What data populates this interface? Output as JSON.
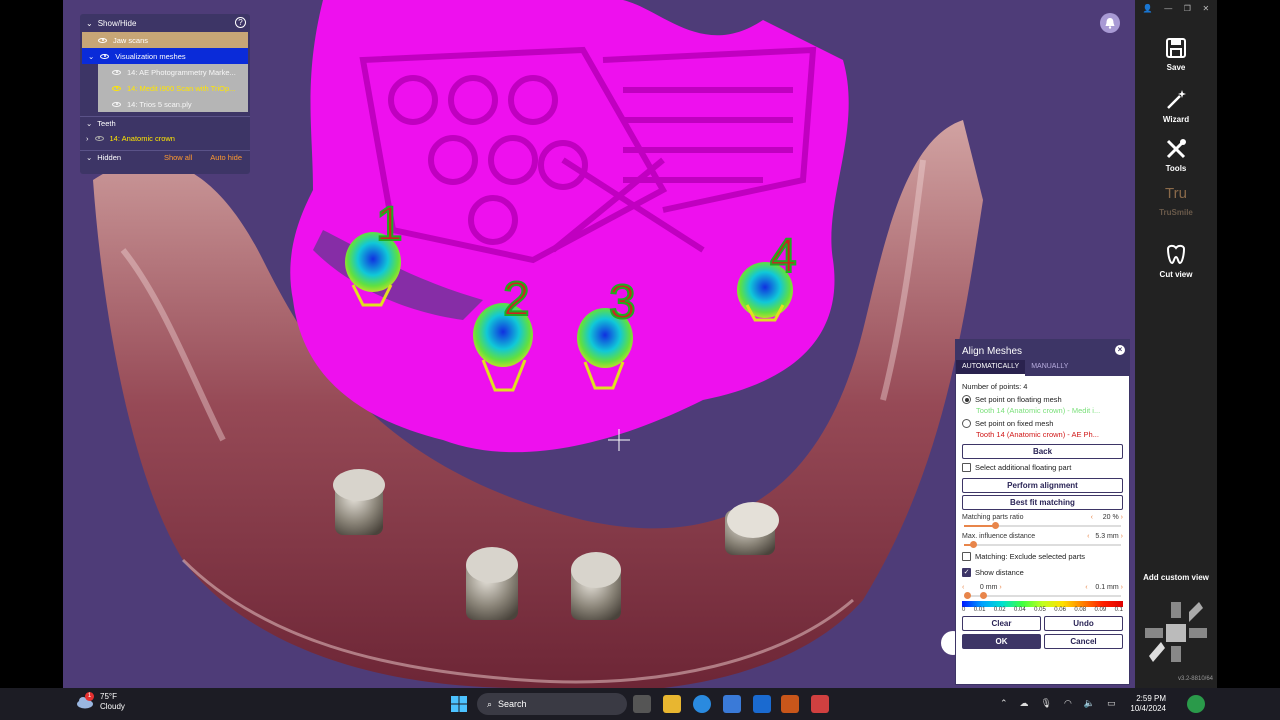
{
  "show_hide": {
    "title": "Show/Hide",
    "help": "?",
    "jaw_scans": "Jaw scans",
    "visualization_meshes": "Visualization meshes",
    "meshes": [
      "14: AE Photogrammetry Marke...",
      "14: Medit i900 Scan with TriOp...",
      "14: Trios 5 scan.ply"
    ],
    "teeth_label": "Teeth",
    "tooth_item": "14: Anatomic crown",
    "hidden_label": "Hidden",
    "show_all": "Show all",
    "auto_hide": "Auto hide"
  },
  "markers": [
    "1",
    "2",
    "3",
    "4"
  ],
  "toolbar": {
    "save": "Save",
    "wizard": "Wizard",
    "tools": "Tools",
    "trusmile_logo": "Tru",
    "trusmile": "TruSmile",
    "cut_view": "Cut view",
    "add_custom_view": "Add custom view",
    "version": "v3.2-8810/64"
  },
  "align": {
    "title": "Align Meshes",
    "close": "×",
    "tab_auto": "AUTOMATICALLY",
    "tab_manual": "MANUALLY",
    "num_points": "Number of points: 4",
    "set_floating": "Set point on floating mesh",
    "floating_value": "Tooth 14 (Anatomic crown) - Medit i...",
    "set_fixed": "Set point on fixed mesh",
    "fixed_value": "Tooth 14 (Anatomic crown) - AE Ph...",
    "back": "Back",
    "select_additional": "Select additional floating part",
    "perform": "Perform alignment",
    "best_fit": "Best fit matching",
    "matching_ratio_label": "Matching parts ratio",
    "matching_ratio_value": "20 %",
    "matching_ratio_level": 0.2,
    "influence_label": "Max. influence distance",
    "influence_value": "5.3 mm",
    "influence_level": 0.05,
    "exclude_label": "Matching: Exclude selected parts",
    "show_distance": "Show distance",
    "dist_min": "0 mm",
    "dist_max": "0.1 mm",
    "scale": [
      "0",
      "0.01",
      "0.02",
      "0.04",
      "0.05",
      "0.06",
      "0.08",
      "0.09",
      "0.1"
    ],
    "clear": "Clear",
    "undo": "Undo",
    "ok": "OK",
    "cancel": "Cancel"
  },
  "taskbar": {
    "weather_badge": "1",
    "temp": "75°F",
    "condition": "Cloudy",
    "search": "Search",
    "time": "2:59 PM",
    "date": "10/4/2024"
  },
  "colors": {
    "viewport_bg": "#4e3c78",
    "magenta": "#ee10ee",
    "panel": "#3d3566",
    "accent_orange": "#e8854a"
  }
}
